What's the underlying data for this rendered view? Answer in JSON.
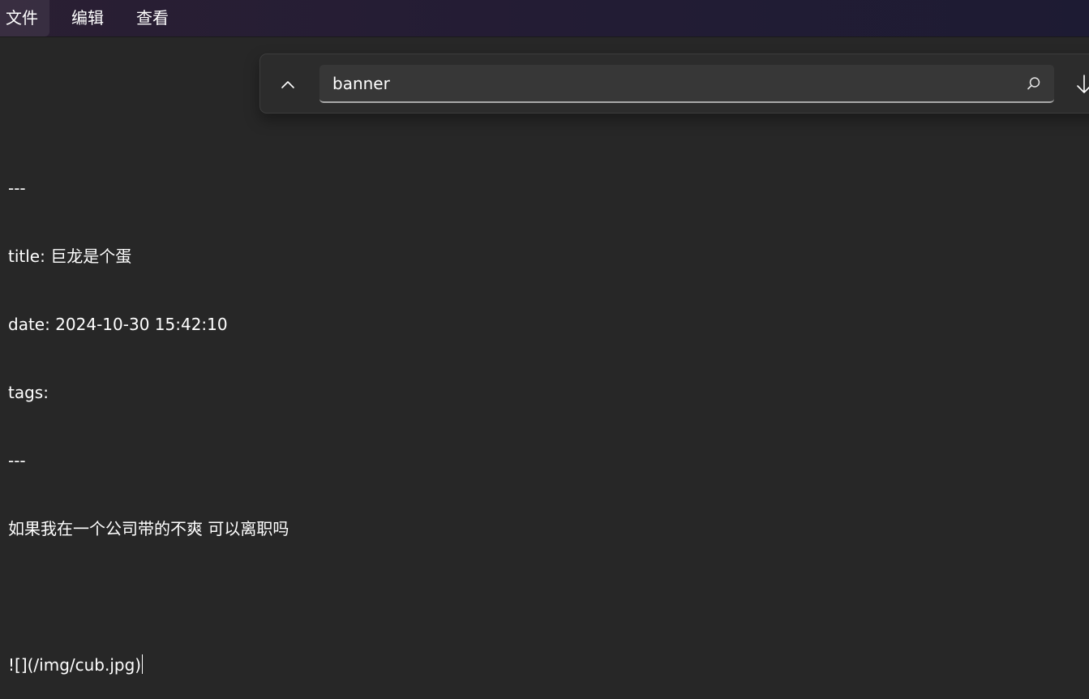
{
  "menubar": {
    "items": [
      {
        "label": "文件"
      },
      {
        "label": "编辑"
      },
      {
        "label": "查看"
      }
    ]
  },
  "find": {
    "query": "banner",
    "prev_icon": "chevron-up-icon",
    "search_icon": "search-icon",
    "next_icon": "arrow-down-icon"
  },
  "editor": {
    "lines": [
      "---",
      "title: 巨龙是个蛋",
      "date: 2024-10-30 15:42:10",
      "tags:",
      "---",
      "如果我在一个公司带的不爽 可以离职吗",
      "",
      "![](/img/cub.jpg)"
    ]
  }
}
